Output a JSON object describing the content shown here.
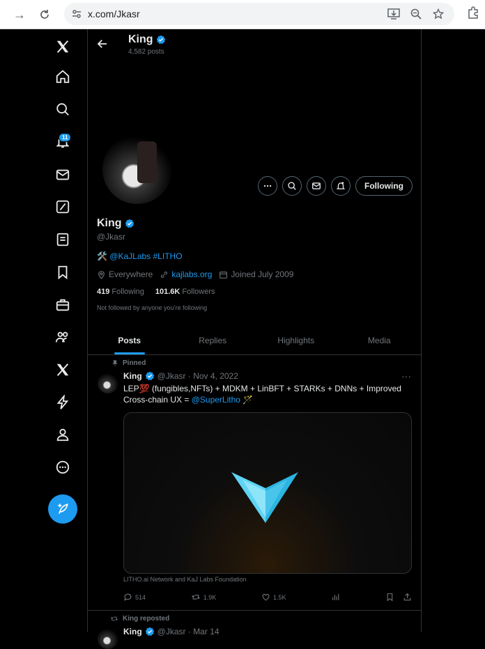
{
  "browser": {
    "url": "x.com/Jkasr"
  },
  "sidebar": {
    "notifications_badge": "11"
  },
  "header": {
    "name": "King",
    "posts_count": "4,582 posts"
  },
  "profile": {
    "name": "King",
    "handle": "@Jkasr",
    "bio_prefix": "🛠️",
    "bio_links": "@KaJLabs #LITHO",
    "location": "Everywhere",
    "website": "kajlabs.org",
    "joined": "Joined July 2009",
    "following_count": "419",
    "following_label": "Following",
    "followers_count": "101.6K",
    "followers_label": "Followers",
    "not_followed": "Not followed by anyone you’re following",
    "following_button": "Following"
  },
  "tabs": [
    "Posts",
    "Replies",
    "Highlights",
    "Media"
  ],
  "pinned_post": {
    "pinned_label": "Pinned",
    "author": "King",
    "handle_date": "@Jkasr · Nov 4, 2022",
    "text_line1": "LEP💯 (fungibles,NFTs) + MDKM + LinBFT + STARKs + DNNs + Improved",
    "text_line2_prefix": "Cross-chain UX = ",
    "text_mention": "@SuperLitho",
    "text_suffix": " 🪄",
    "caption": "LITHO.ai Network and KaJ Labs Foundation",
    "replies": "514",
    "reposts": "1.9K",
    "likes": "1.5K"
  },
  "next_post": {
    "repost_label": "King reposted",
    "author": "King",
    "handle_date": "@Jkasr · Mar 14"
  },
  "colors": {
    "accent": "#1d9bf0",
    "background": "#000000",
    "muted": "#71767b"
  }
}
